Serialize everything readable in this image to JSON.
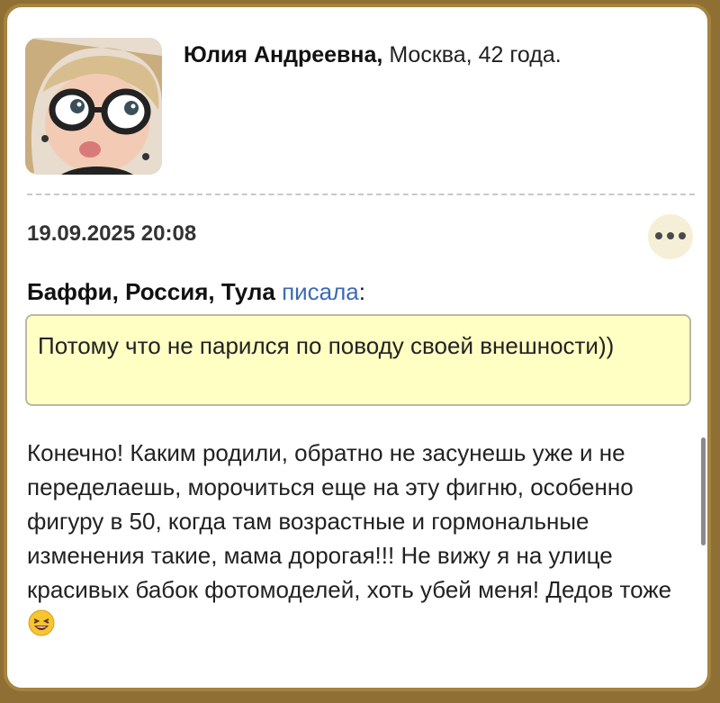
{
  "post": {
    "author_name": "Юлия Андреевна,",
    "author_location": "Москва, 42 года.",
    "timestamp": "19.09.2025 20:08"
  },
  "quote": {
    "author": "Баффи, Россия, Тула",
    "link_label": "писала",
    "colon": ":",
    "text": "Потому что не парился по поводу своей внешности))"
  },
  "reply": {
    "text": "Конечно! Каким родили, обратно не засунешь уже и не переделаешь, морочиться еще на эту фигню, особенно фигуру в 50, когда там возрастные и гормональные изменения такие, мама дорогая!!! Не вижу я на улице красивых бабок фотомоделей, хоть убей меня! Дедов тоже",
    "emoji": "laughing-face"
  },
  "colors": {
    "frame": "#a5843f",
    "quote_bg": "#ffffc3",
    "link": "#3d6ab4"
  }
}
